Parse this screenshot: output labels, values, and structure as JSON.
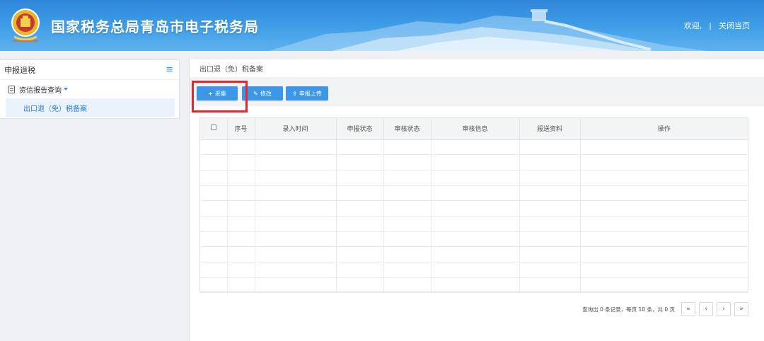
{
  "header": {
    "title": "国家税务总局青岛市电子税务局",
    "welcome": "欢迎,",
    "separator": "|",
    "close_link": "关闭当页"
  },
  "sidebar": {
    "heading": "申报退税",
    "menu_icon": "hamburger-icon",
    "group_label": "资信报告查询",
    "active_item": "出口退（免）税备案"
  },
  "breadcrumb": "出口退（免）税备案",
  "toolbar": {
    "collect_label": "采集",
    "modify_label": "修改",
    "upload_label": "申报上传",
    "button_color": "#3d97e7",
    "highlight_color": "#e5262f"
  },
  "table": {
    "columns": [
      "序号",
      "录入时间",
      "申报状态",
      "审核状态",
      "审核信息",
      "报送资料",
      "操作"
    ],
    "rows": []
  },
  "pagination": {
    "info": "查询出 0 条记录，每页 10 条，共 0 页",
    "first": "«",
    "prev": "‹",
    "next": "›",
    "last": "»"
  }
}
